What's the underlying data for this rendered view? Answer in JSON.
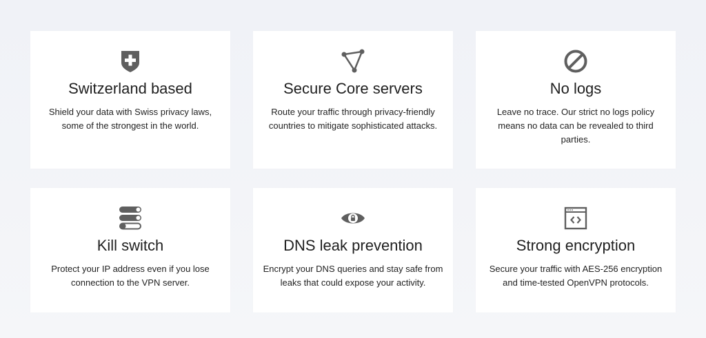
{
  "features": [
    {
      "icon": "shield-swiss-cross-icon",
      "title": "Switzerland based",
      "description": "Shield your data with Swiss privacy laws, some of the strongest in the world."
    },
    {
      "icon": "triangle-nodes-icon",
      "title": "Secure Core servers",
      "description": "Route your traffic through privacy-friendly countries to mitigate sophisticated attacks."
    },
    {
      "icon": "no-entry-icon",
      "title": "No logs",
      "description": "Leave no trace. Our strict no logs policy means no data can be revealed to third parties."
    },
    {
      "icon": "toggle-stack-icon",
      "title": "Kill switch",
      "description": "Protect your IP address even if you lose connection to the VPN server."
    },
    {
      "icon": "eye-lock-icon",
      "title": "DNS leak prevention",
      "description": "Encrypt your DNS queries and stay safe from leaks that could expose your activity."
    },
    {
      "icon": "code-window-icon",
      "title": "Strong encryption",
      "description": "Secure your traffic with AES-256 encryption and time-tested OpenVPN protocols."
    }
  ],
  "colors": {
    "icon": "#5f5f5f",
    "card": "#ffffff",
    "background": "#f2f4f8"
  }
}
